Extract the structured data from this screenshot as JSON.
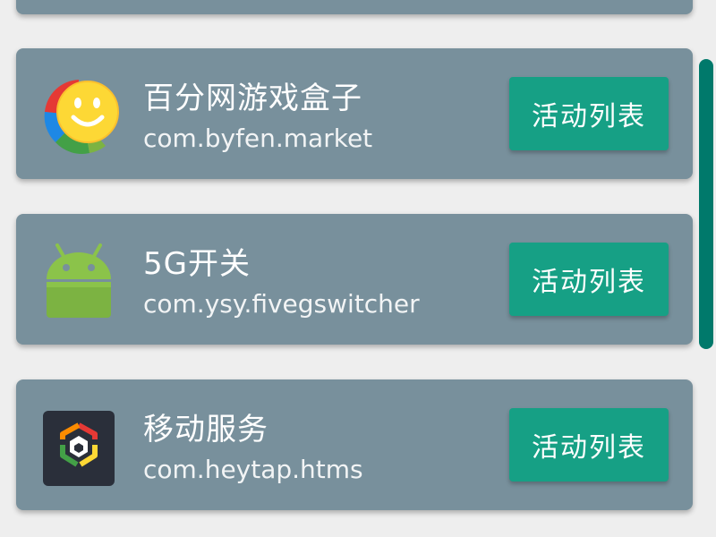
{
  "apps": [
    {
      "name": "百分网游戏盒子",
      "package": "com.byfen.market",
      "button_label": "活动列表",
      "icon": "byfen-smiley-icon"
    },
    {
      "name": "5G开关",
      "package": "com.ysy.fivegswitcher",
      "button_label": "活动列表",
      "icon": "android-robot-icon"
    },
    {
      "name": "移动服务",
      "package": "com.heytap.htms",
      "button_label": "活动列表",
      "icon": "heytap-hexagon-icon"
    }
  ],
  "colors": {
    "card_background": "#78909c",
    "button_background": "#16a085",
    "scrollbar": "#00796b",
    "page_background": "#eeeeee"
  }
}
